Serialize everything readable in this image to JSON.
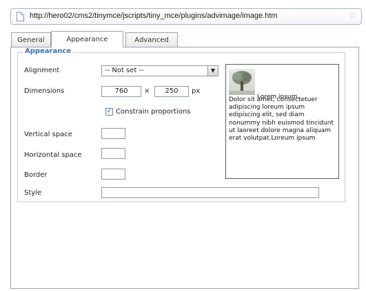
{
  "browser": {
    "url": "http://hero02/cms2/tinymce/jscripts/tiny_mce/plugins/advimage/image.htm"
  },
  "tabs": [
    {
      "label": "General",
      "active": false
    },
    {
      "label": "Appearance",
      "active": true
    },
    {
      "label": "Advanced",
      "active": false
    }
  ],
  "appearance": {
    "legend": "Appearance",
    "alignment": {
      "label": "Alignment",
      "value": "-- Not set --"
    },
    "dimensions": {
      "label": "Dimensions",
      "width": "760",
      "separator": "×",
      "height": "250",
      "unit": "px"
    },
    "constrain": {
      "label": "Constrain proportions",
      "checked": true
    },
    "vspace": {
      "label": "Vertical space",
      "value": ""
    },
    "hspace": {
      "label": "Horizontal space",
      "value": ""
    },
    "border": {
      "label": "Border",
      "value": ""
    },
    "style": {
      "label": "Style",
      "value": ""
    },
    "preview": {
      "first_line": "Lorem ipsum.",
      "body": "Dolor sit amet, consectetuer adipiscing loreum ipsum edipiscing elit, sed diam nonummy nibh euismod tincidunt ut laoreet dolore magna aliquam erat volutpat.Loreum ipsum"
    }
  },
  "colors": {
    "legend": "#3d6fb0",
    "checkmark": "#2a58a6"
  }
}
